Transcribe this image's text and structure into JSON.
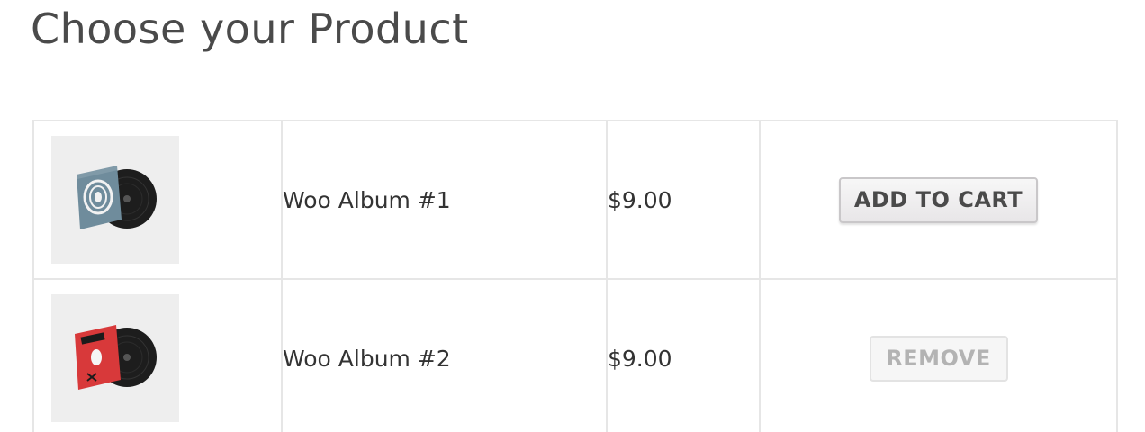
{
  "page": {
    "title": "Choose your Product"
  },
  "products": [
    {
      "name": "Woo Album #1",
      "price": "$9.00",
      "action_label": "ADD TO CART",
      "sleeve_color": "#6f8c9c",
      "icon": "vinyl-album-icon"
    },
    {
      "name": "Woo Album #2",
      "price": "$9.00",
      "action_label": "REMOVE",
      "sleeve_color": "#d8393a",
      "icon": "vinyl-album-icon"
    }
  ]
}
